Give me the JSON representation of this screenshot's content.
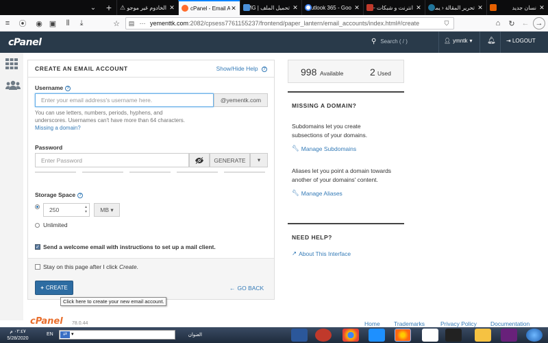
{
  "browser": {
    "tabs": [
      {
        "title": "نسان جديد",
        "active": false,
        "color": "#e66000"
      },
      {
        "title": "تحرير المقالة ‹ يمن",
        "active": false,
        "color": "#21759b"
      },
      {
        "title": "انترنت و شبكات – يم",
        "active": false,
        "color": "#c0392b"
      },
      {
        "title": "outlook 365 - Goo",
        "active": false,
        "color": "#ffffff"
      },
      {
        "title": "تحميل الملف | IMG",
        "active": false,
        "color": "#4a90d9"
      },
      {
        "title": "cPanel - Email Acc",
        "active": true,
        "color": "#ff6c2c"
      },
      {
        "title": "الخادوم غير موجود",
        "active": false,
        "color": "#333333"
      }
    ],
    "url_prefix": "yementtk.com",
    "url_rest": ":2082/cpsess7761155237/frontend/paper_lantern/email_accounts/index.html#/create"
  },
  "header": {
    "logo": "cPanel",
    "search_placeholder": "Search ( / )",
    "user": "ymntk",
    "logout": "LOGOUT"
  },
  "form": {
    "title": "CREATE AN EMAIL ACCOUNT",
    "show_hide_help": "Show/Hide Help",
    "username_label": "Username",
    "username_placeholder": "Enter your email address's username here.",
    "domain_addon": "@yementk.com",
    "username_hint_1": "You can use letters, numbers, periods, hyphens, and",
    "username_hint_2": "underscores. Usernames can't have more than 64 characters.",
    "missing_domain_link": "Missing a domain?",
    "password_label": "Password",
    "password_placeholder": "Enter Password",
    "generate_label": "GENERATE",
    "storage_label": "Storage Space",
    "storage_value": "250",
    "storage_unit": "MB",
    "unlimited_label": "Unlimited",
    "welcome_email_label": "Send a welcome email with instructions to set up a mail client.",
    "stay_label_prefix": "Stay on this page after I click ",
    "stay_label_em": "Create",
    "stay_label_suffix": ".",
    "create_button": "CREATE",
    "go_back": "GO BACK",
    "tooltip": "Click here to create your new email account.",
    "welcome_checked": true,
    "stay_checked": false,
    "storage_mode": "limited"
  },
  "sidebar_right": {
    "available_count": "998",
    "available_label": "Available",
    "used_count": "2",
    "used_label": "Used",
    "missing_domain_title": "MISSING A DOMAIN?",
    "missing_domain_text": "Subdomains let you create subsections of your domains.",
    "manage_subdomains": "Manage Subdomains",
    "aliases_text": "Aliases let you point a domain towards another of your domains' content.",
    "manage_aliases": "Manage Aliases",
    "need_help_title": "NEED HELP?",
    "about_interface": "About This Interface"
  },
  "footer": {
    "logo": "cPanel",
    "version": "78.0.44",
    "links": [
      "Home",
      "Trademarks",
      "Privacy Policy",
      "Documentation"
    ]
  },
  "taskbar": {
    "time": "٠٢:٤٧ م",
    "date": "5/28/2020",
    "lang": "EN",
    "address_label": "العنوان"
  },
  "colors": {
    "header_bg": "#293a4a",
    "link": "#337ab7",
    "primary_button": "#2d6ca2"
  }
}
